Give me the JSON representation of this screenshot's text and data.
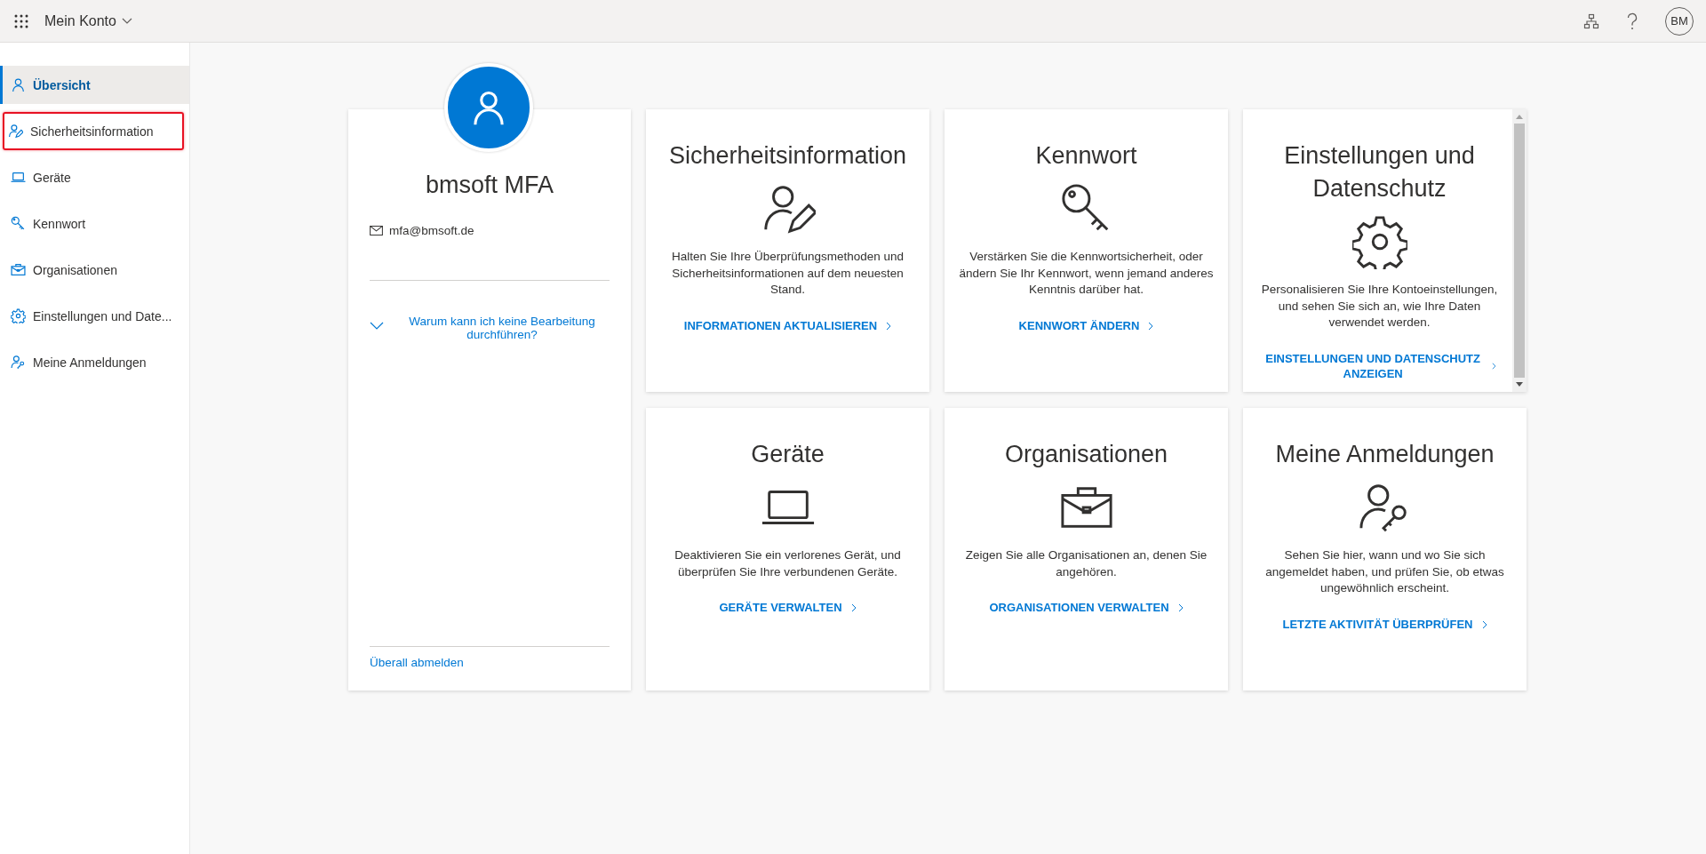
{
  "topbar": {
    "app_title": "Mein Konto",
    "avatar_initials": "BM"
  },
  "sidebar": {
    "items": [
      {
        "label": "Übersicht",
        "selected": true,
        "outlined": false
      },
      {
        "label": "Sicherheitsinformation",
        "selected": false,
        "outlined": true
      },
      {
        "label": "Geräte",
        "selected": false,
        "outlined": false
      },
      {
        "label": "Kennwort",
        "selected": false,
        "outlined": false
      },
      {
        "label": "Organisationen",
        "selected": false,
        "outlined": false
      },
      {
        "label": "Einstellungen und Date...",
        "selected": false,
        "outlined": false
      },
      {
        "label": "Meine Anmeldungen",
        "selected": false,
        "outlined": false
      }
    ]
  },
  "profile": {
    "name": "bmsoft MFA",
    "email": "mfa@bmsoft.de",
    "help_link": "Warum kann ich keine Bearbeitung durchführen?",
    "sign_out_link": "Überall abmelden"
  },
  "tiles": [
    {
      "title": "Sicherheitsinformation",
      "description": "Halten Sie Ihre Überprüfungsmethoden und Sicherheitsinformationen auf dem neuesten Stand.",
      "link": "INFORMATIONEN AKTUALISIEREN",
      "scrollbar": false
    },
    {
      "title": "Kennwort",
      "description": "Verstärken Sie die Kennwortsicherheit, oder ändern Sie Ihr Kennwort, wenn jemand anderes Kenntnis darüber hat.",
      "link": "KENNWORT ÄNDERN",
      "scrollbar": false
    },
    {
      "title": "Einstellungen und Datenschutz",
      "description": "Personalisieren Sie Ihre Kontoeinstellungen, und sehen Sie sich an, wie Ihre Daten verwendet werden.",
      "link": "EINSTELLUNGEN UND DATENSCHUTZ ANZEIGEN",
      "scrollbar": true
    },
    {
      "title": "Geräte",
      "description": "Deaktivieren Sie ein verlorenes Gerät, und überprüfen Sie Ihre verbundenen Geräte.",
      "link": "GERÄTE VERWALTEN",
      "scrollbar": false
    },
    {
      "title": "Organisationen",
      "description": "Zeigen Sie alle Organisationen an, denen Sie angehören.",
      "link": "ORGANISATIONEN VERWALTEN",
      "scrollbar": false
    },
    {
      "title": "Meine Anmeldungen",
      "description": "Sehen Sie hier, wann und wo Sie sich angemeldet haben, und prüfen Sie, ob etwas ungewöhnlich erscheint.",
      "link": "LETZTE AKTIVITÄT ÜBERPRÜFEN",
      "scrollbar": false
    }
  ]
}
